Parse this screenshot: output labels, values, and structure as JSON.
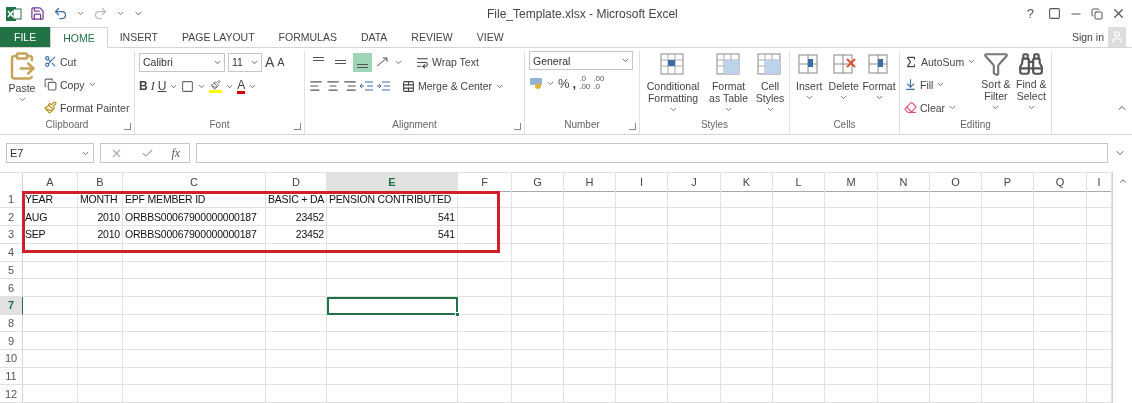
{
  "title_bar": {
    "title": "File_Template.xlsx - Microsoft Excel",
    "help": "?"
  },
  "tabs": [
    {
      "label": "FILE",
      "kind": "file",
      "selected": false
    },
    {
      "label": "HOME",
      "kind": "tab",
      "selected": true
    },
    {
      "label": "INSERT",
      "kind": "tab",
      "selected": false
    },
    {
      "label": "PAGE LAYOUT",
      "kind": "tab",
      "selected": false
    },
    {
      "label": "FORMULAS",
      "kind": "tab",
      "selected": false
    },
    {
      "label": "DATA",
      "kind": "tab",
      "selected": false
    },
    {
      "label": "REVIEW",
      "kind": "tab",
      "selected": false
    },
    {
      "label": "VIEW",
      "kind": "tab",
      "selected": false
    }
  ],
  "sign_in": "Sign in",
  "ribbon": [
    {
      "kind": "clipboard",
      "label": "Clipboard",
      "paste": "Paste",
      "cut": "Cut",
      "copy": "Copy",
      "format_painter": "Format Painter"
    },
    {
      "kind": "font",
      "label": "Font",
      "font_name": "Calibri",
      "font_size": "11",
      "grow": "A",
      "shrink": "A",
      "bold": "B",
      "italic": "I",
      "underline": "U",
      "font_color": "A"
    },
    {
      "kind": "alignment",
      "label": "Alignment",
      "wrap_text": "Wrap Text",
      "merge": "Merge & Center",
      "vertical_align": [
        {
          "selected": false
        },
        {
          "selected": false
        },
        {
          "selected": true
        }
      ]
    },
    {
      "kind": "number",
      "label": "Number",
      "format": "General",
      "percent": "%",
      "comma": ",",
      "increase_decimal": [
        ".0",
        ".00"
      ],
      "decrease_decimal": [
        ".00",
        ".0"
      ]
    },
    {
      "kind": "styles",
      "label": "Styles",
      "buttons": [
        "Conditional Formatting",
        "Format as Table",
        "Cell Styles"
      ]
    },
    {
      "kind": "cells",
      "label": "Cells",
      "buttons": [
        "Insert",
        "Delete",
        "Format"
      ]
    },
    {
      "kind": "editing",
      "label": "Editing",
      "autosum": "AutoSum",
      "fill": "Fill",
      "clear": "Clear",
      "sort": "Sort & Filter",
      "find": "Find & Select"
    }
  ],
  "formula_bar": {
    "name_box": "E7",
    "fx": "fx"
  },
  "sheet": {
    "columns": [
      {
        "label": "A",
        "selected": false
      },
      {
        "label": "B",
        "selected": false
      },
      {
        "label": "C",
        "selected": false
      },
      {
        "label": "D",
        "selected": false
      },
      {
        "label": "E",
        "selected": true
      },
      {
        "label": "F",
        "selected": false
      },
      {
        "label": "G",
        "selected": false
      },
      {
        "label": "H",
        "selected": false
      },
      {
        "label": "I",
        "selected": false
      },
      {
        "label": "J",
        "selected": false
      },
      {
        "label": "K",
        "selected": false
      },
      {
        "label": "L",
        "selected": false
      },
      {
        "label": "M",
        "selected": false
      },
      {
        "label": "N",
        "selected": false
      },
      {
        "label": "O",
        "selected": false
      },
      {
        "label": "P",
        "selected": false
      },
      {
        "label": "Q",
        "selected": false
      },
      {
        "label": "I",
        "selected": false
      }
    ],
    "rows": [
      {
        "header": "1",
        "selected": false,
        "cells": [
          {
            "text": "YEAR",
            "kind": "text"
          },
          {
            "text": "MONTH",
            "kind": "text"
          },
          {
            "text": "EPF MEMBER ID",
            "kind": "text"
          },
          {
            "text": "BASIC + DA",
            "kind": "text"
          },
          {
            "text": "PENSION CONTRIBUTED",
            "kind": "text"
          }
        ]
      },
      {
        "header": "2",
        "selected": false,
        "cells": [
          {
            "text": "AUG",
            "kind": "text"
          },
          {
            "text": "2010",
            "kind": "number"
          },
          {
            "text": "ORBBS00067900000000187",
            "kind": "text"
          },
          {
            "text": "23452",
            "kind": "number"
          },
          {
            "text": "541",
            "kind": "number"
          }
        ]
      },
      {
        "header": "3",
        "selected": false,
        "cells": [
          {
            "text": "SEP",
            "kind": "text"
          },
          {
            "text": "2010",
            "kind": "number"
          },
          {
            "text": "ORBBS00067900000000187",
            "kind": "text"
          },
          {
            "text": "23452",
            "kind": "number"
          },
          {
            "text": "541",
            "kind": "number"
          }
        ]
      },
      {
        "header": "4",
        "selected": false
      },
      {
        "header": "5",
        "selected": false
      },
      {
        "header": "6",
        "selected": false
      },
      {
        "header": "7",
        "selected": true
      },
      {
        "header": "8",
        "selected": false
      },
      {
        "header": "9",
        "selected": false
      },
      {
        "header": "10",
        "selected": false
      },
      {
        "header": "11",
        "selected": false
      },
      {
        "header": "12",
        "selected": false
      }
    ],
    "annotation_box": true
  }
}
